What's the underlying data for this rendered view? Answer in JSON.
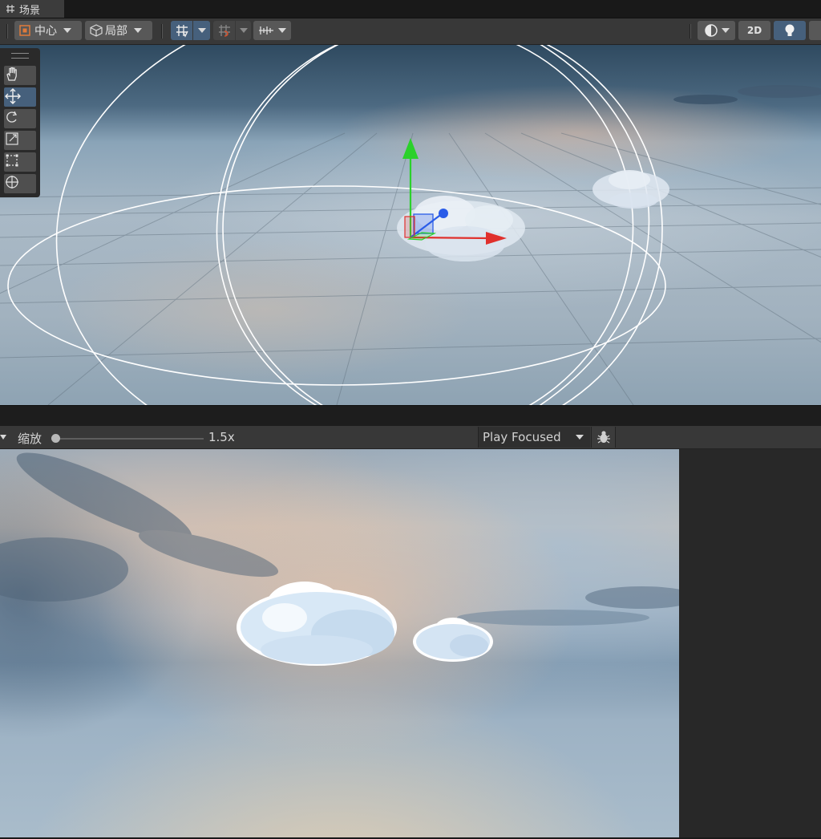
{
  "scene_tab": {
    "icon": "scene-grid-icon",
    "label": "场景"
  },
  "scene_toolbar": {
    "pivot": {
      "icon": "pivot-center-icon",
      "label": "中心"
    },
    "space": {
      "icon": "cube-local-icon",
      "label": "局部"
    },
    "grid_snap": {
      "icon": "grid-snap-icon"
    },
    "increment_snap": {
      "icon": "increment-snap-icon"
    },
    "ruler": {
      "icon": "ruler-icon"
    },
    "right": {
      "shading": "shading-mode-icon",
      "mode_2d": "2D",
      "lighting": "lightbulb-icon"
    }
  },
  "tools": [
    {
      "name": "hand-tool",
      "icon": "hand-icon",
      "active": false
    },
    {
      "name": "move-tool",
      "icon": "move-arrows-icon",
      "active": true
    },
    {
      "name": "rotate-tool",
      "icon": "rotate-icon",
      "active": false
    },
    {
      "name": "scale-tool",
      "icon": "scale-icon",
      "active": false
    },
    {
      "name": "rect-tool",
      "icon": "rect-transform-icon",
      "active": false
    },
    {
      "name": "transform-tool",
      "icon": "transform-icon",
      "active": false
    }
  ],
  "game_toolbar": {
    "zoom_label": "缩放",
    "zoom_value": "1.5x",
    "zoom_fraction": 0.0,
    "play_mode": "Play Focused",
    "debug_icon": "bug-icon"
  },
  "colors": {
    "accent": "#46607c",
    "gizmo_x": "#e0302c",
    "gizmo_y": "#2bd12b",
    "gizmo_z": "#2a5ce8",
    "panel": "#383838"
  }
}
